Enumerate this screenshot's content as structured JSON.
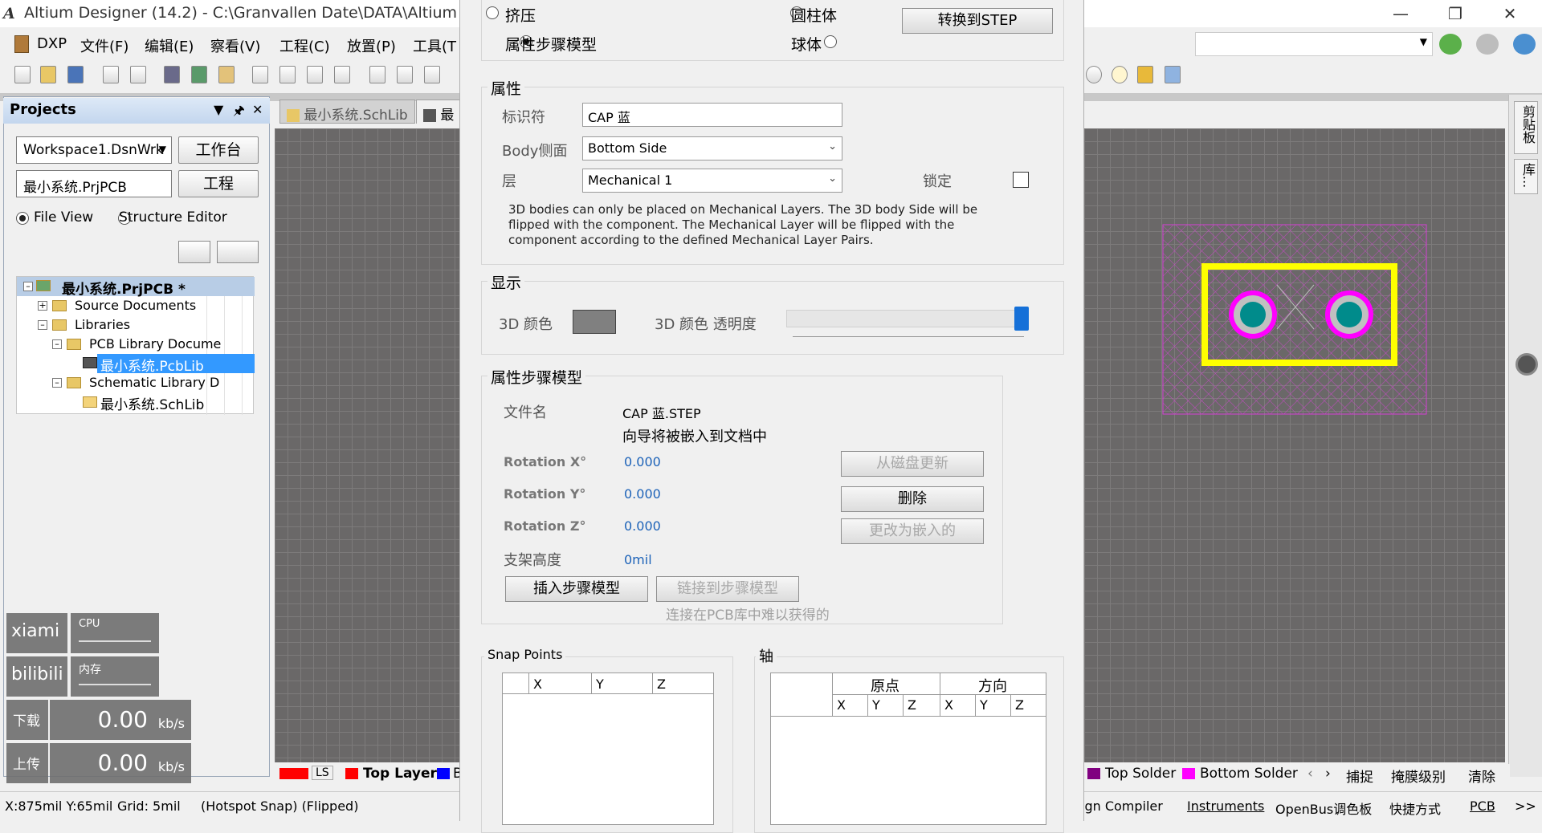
{
  "window": {
    "logo": "A",
    "title": "Altium Designer (14.2) - C:\\Granvallen Date\\DATA\\Altium Desi"
  },
  "menu": [
    "DXP",
    "文件(F)",
    "编辑(E)",
    "察看(V)",
    "工程(C)",
    "放置(P)",
    "工具(T"
  ],
  "projects": {
    "title": "Projects",
    "workspace": "Workspace1.DsnWrk",
    "workspace_btn": "工作台",
    "project": "最小系统.PrjPCB",
    "project_btn": "工程",
    "view_file": "File View",
    "view_structure": "Structure Editor",
    "tree": [
      "最小系统.PrjPCB *",
      "Source Documents",
      "Libraries",
      "PCB Library Docume",
      "最小系统.PcbLib",
      "Schematic Library D",
      "最小系统.SchLib"
    ]
  },
  "doc_tabs": [
    "最小系统.SchLib",
    "最"
  ],
  "right_strip": [
    "剪贴板",
    "库..."
  ],
  "layers": {
    "ls": "LS",
    "top": "Top Layer",
    "b": "B",
    "top_solder": "Top Solder",
    "bottom_solder": "Bottom Solder",
    "snap": "捕捉",
    "mask": "掩膜级别",
    "clear": "清除",
    "colors": {
      "top": "#ff0000",
      "bottom": "#0000ff",
      "top_solder": "#800080",
      "bottom_solder": "#ff00ff"
    }
  },
  "status": {
    "coords": "X:875mil Y:65mil",
    "grid": "Grid: 5mil",
    "snap": "(Hotspot Snap) (Flipped)",
    "panels": [
      "ign Compiler",
      "Instruments",
      "OpenBus调色板",
      "快捷方式",
      "PCB",
      ">>"
    ]
  },
  "widget": {
    "labels": [
      "xiami",
      "bilibili",
      "下载",
      "上传"
    ],
    "cpu": "CPU",
    "mem": "内存",
    "download": "0.00",
    "upload": "0.00",
    "unit": "kb/s"
  },
  "dialog": {
    "shape": {
      "extrude": "挤压",
      "cylinder": "圆柱体",
      "step_model": "属性步骤模型",
      "sphere": "球体",
      "convert_btn": "转换到STEP"
    },
    "props": {
      "group": "属性",
      "id_label": "标识符",
      "id_value": "CAP  蓝",
      "body_side_label": "Body侧面",
      "body_side_value": "Bottom Side",
      "layer_label": "层",
      "layer_value": "Mechanical 1",
      "lock_label": "锁定",
      "note": "3D bodies can only be placed on Mechanical Layers. The 3D body Side will be flipped with the component. The Mechanical Layer will be flipped with the component according to the defined Mechanical Layer Pairs."
    },
    "display": {
      "group": "显示",
      "color_label": "3D 颜色",
      "color_value": "#808080",
      "opacity_label": "3D 颜色 透明度"
    },
    "step": {
      "group": "属性步骤模型",
      "filename_label": "文件名",
      "filename": "CAP  蓝.STEP",
      "embed_note": "向导将被嵌入到文档中",
      "rot_x_label": "Rotation X°",
      "rot_x": "0.000",
      "rot_y_label": "Rotation Y°",
      "rot_y": "0.000",
      "rot_z_label": "Rotation Z°",
      "rot_z": "0.000",
      "standoff_label": "支架高度",
      "standoff": "0mil",
      "update_btn": "从磁盘更新",
      "delete_btn": "删除",
      "embed_btn": "更改为嵌入的",
      "insert_btn": "插入步骤模型",
      "link_btn": "链接到步骤模型",
      "link_note": "连接在PCB库中难以获得的"
    },
    "snap_points": {
      "group": "Snap Points",
      "cols": [
        "X",
        "Y",
        "Z"
      ]
    },
    "axis": {
      "group": "轴",
      "origin": "原点",
      "direction": "方向",
      "cols": [
        "X",
        "Y",
        "Z",
        "X",
        "Y",
        "Z"
      ]
    }
  }
}
